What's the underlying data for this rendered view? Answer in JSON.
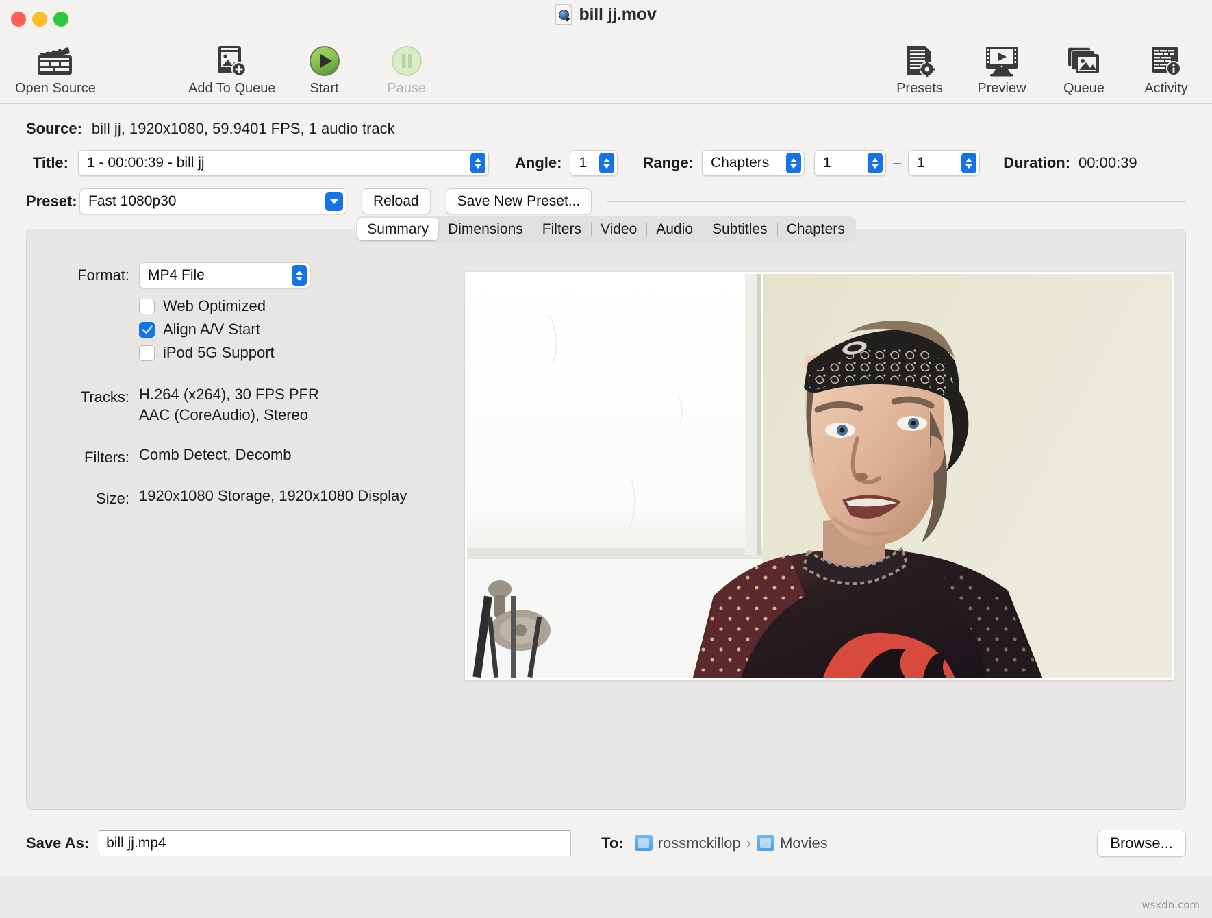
{
  "window": {
    "title": "bill jj.mov",
    "doc_icon": "quicktime-movie-icon"
  },
  "toolbar": {
    "items": [
      {
        "label": "Open Source",
        "icon": "clapperboard-icon",
        "enabled": true
      },
      {
        "label": "Add To Queue",
        "icon": "add-to-queue-icon",
        "enabled": true
      },
      {
        "label": "Start",
        "icon": "play-circle-icon",
        "enabled": true
      },
      {
        "label": "Pause",
        "icon": "pause-circle-icon",
        "enabled": false
      },
      {
        "label": "Presets",
        "icon": "presets-gear-icon",
        "enabled": true
      },
      {
        "label": "Preview",
        "icon": "monitor-play-icon",
        "enabled": true
      },
      {
        "label": "Queue",
        "icon": "stacked-photos-icon",
        "enabled": true
      },
      {
        "label": "Activity",
        "icon": "activity-info-icon",
        "enabled": true
      }
    ]
  },
  "source": {
    "label": "Source:",
    "value": "bill jj, 1920x1080, 59.9401 FPS, 1 audio track"
  },
  "title_row": {
    "label": "Title:",
    "value": "1 - 00:00:39 - bill jj",
    "angle_label": "Angle:",
    "angle_value": "1",
    "range_label": "Range:",
    "range_type": "Chapters",
    "range_start": "1",
    "range_dash": "–",
    "range_end": "1",
    "duration_label": "Duration:",
    "duration_value": "00:00:39"
  },
  "preset_row": {
    "label": "Preset:",
    "value": "Fast 1080p30",
    "reload_label": "Reload",
    "save_preset_label": "Save New Preset..."
  },
  "tabs": [
    {
      "label": "Summary",
      "active": true
    },
    {
      "label": "Dimensions",
      "active": false
    },
    {
      "label": "Filters",
      "active": false
    },
    {
      "label": "Video",
      "active": false
    },
    {
      "label": "Audio",
      "active": false
    },
    {
      "label": "Subtitles",
      "active": false
    },
    {
      "label": "Chapters",
      "active": false
    }
  ],
  "summary": {
    "format_label": "Format:",
    "format_value": "MP4 File",
    "checkboxes": [
      {
        "label": "Web Optimized",
        "checked": false
      },
      {
        "label": "Align A/V Start",
        "checked": true
      },
      {
        "label": "iPod 5G Support",
        "checked": false
      }
    ],
    "tracks_label": "Tracks:",
    "tracks_line1": "H.264 (x264), 30 FPS PFR",
    "tracks_line2": "AAC (CoreAudio), Stereo",
    "filters_label": "Filters:",
    "filters_value": "Comb Detect, Decomb",
    "size_label": "Size:",
    "size_value": "1920x1080 Storage, 1920x1080 Display"
  },
  "bottom": {
    "save_as_label": "Save As:",
    "save_as_value": "bill jj.mp4",
    "to_label": "To:",
    "path_home": "rossmckillop",
    "path_sep": "›",
    "path_folder": "Movies",
    "browse_label": "Browse..."
  },
  "watermark": "wsxdn.com",
  "colors": {
    "accent_blue": "#1473e6",
    "window_bg": "#f3f2f1",
    "panel_bg": "#e8e6e4",
    "start_green": "#7ac143"
  }
}
